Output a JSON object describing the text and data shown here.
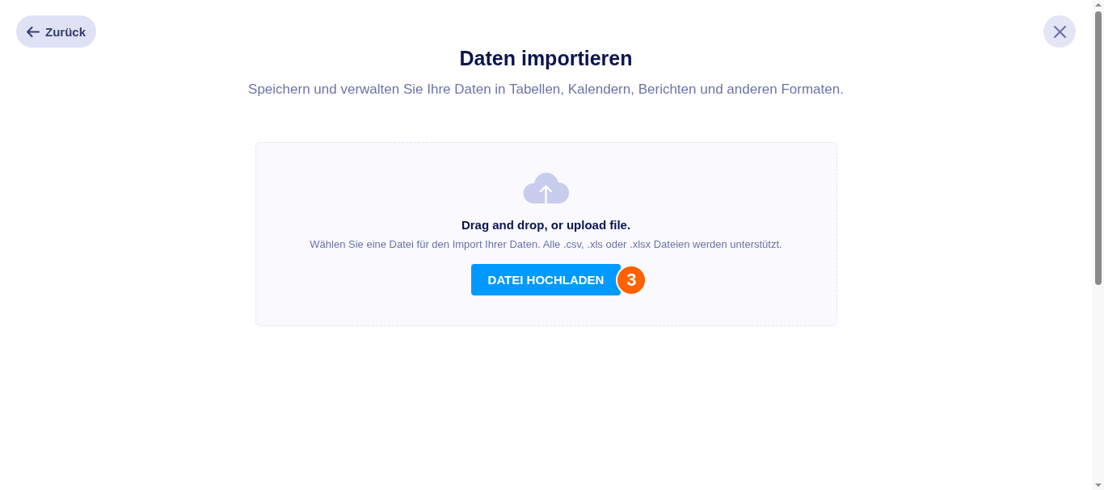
{
  "back_button": {
    "label": "Zurück"
  },
  "title": "Daten importieren",
  "subtitle": "Speichern und verwalten Sie Ihre Daten in Tabellen, Kalendern, Berichten und anderen Formaten.",
  "dropzone": {
    "heading": "Drag and drop, or upload file.",
    "description": "Wählen Sie eine Datei für den Import Ihrer Daten. Alle .csv, .xls oder .xlsx Dateien werden unterstützt.",
    "button": {
      "label": "DATEI HOCHLADEN"
    },
    "badge": "3"
  }
}
